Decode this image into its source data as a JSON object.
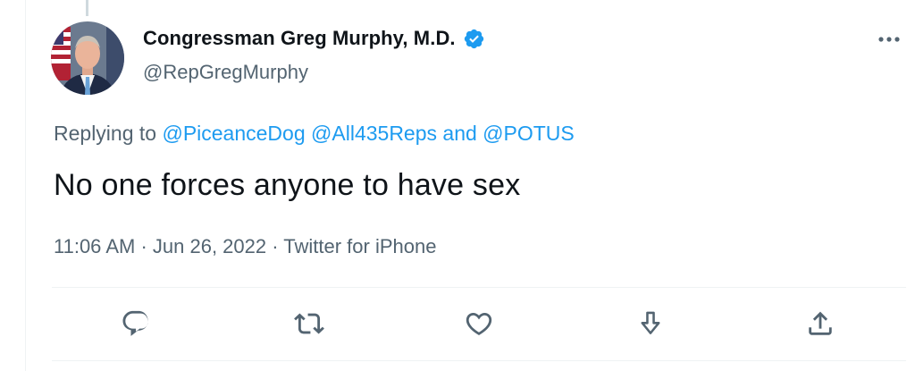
{
  "author": {
    "display_name": "Congressman Greg Murphy, M.D.",
    "handle": "@RepGregMurphy",
    "verified": true
  },
  "reply": {
    "prefix": "Replying to ",
    "mentions": [
      "@PiceanceDog",
      "@All435Reps",
      "@POTUS"
    ],
    "separator_and": " and "
  },
  "tweet": {
    "text": "No one forces anyone to have sex"
  },
  "meta": {
    "time": "11:06 AM",
    "dot": " · ",
    "date": "Jun 26, 2022",
    "source": "Twitter for iPhone"
  },
  "actions": [
    {
      "name": "reply",
      "icon": "reply-icon"
    },
    {
      "name": "retweet",
      "icon": "retweet-icon"
    },
    {
      "name": "like",
      "icon": "heart-icon"
    },
    {
      "name": "bookmark",
      "icon": "bookmark-download-icon"
    },
    {
      "name": "share",
      "icon": "share-icon"
    }
  ],
  "colors": {
    "accent": "#1d9bf0",
    "text": "#0f1419",
    "secondary": "#536471",
    "divider": "#eff3f4"
  }
}
